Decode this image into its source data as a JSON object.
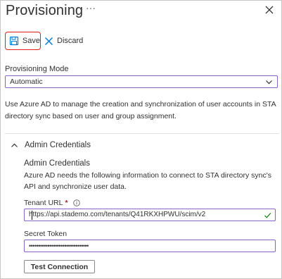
{
  "header": {
    "title": "Provisioning",
    "more_label": "···"
  },
  "toolbar": {
    "save_label": "Save",
    "discard_label": "Discard"
  },
  "provisioning_mode": {
    "label": "Provisioning Mode",
    "selected": "Automatic"
  },
  "description": "Use Azure AD to manage the creation and synchronization of user accounts in STA directory sync based on user and group assignment.",
  "admin_credentials": {
    "section_label": "Admin Credentials",
    "subtitle": "Admin Credentials",
    "description": "Azure AD needs the following information to connect to STA directory sync's API and synchronize user data.",
    "tenant_url": {
      "label": "Tenant URL",
      "required_mark": "*",
      "value": "https://api.stademo.com/tenants/Q41RKXHPWU/scim/v2"
    },
    "secret_token": {
      "label": "Secret Token",
      "value": "••••••••••••••••••••••••••••••••"
    },
    "test_button_label": "Test Connection"
  },
  "colors": {
    "focus_border": "#8a63c8",
    "highlight_border": "#e02020",
    "accent_blue": "#0078d4",
    "valid_green": "#107c10",
    "required_red": "#a4262c"
  }
}
